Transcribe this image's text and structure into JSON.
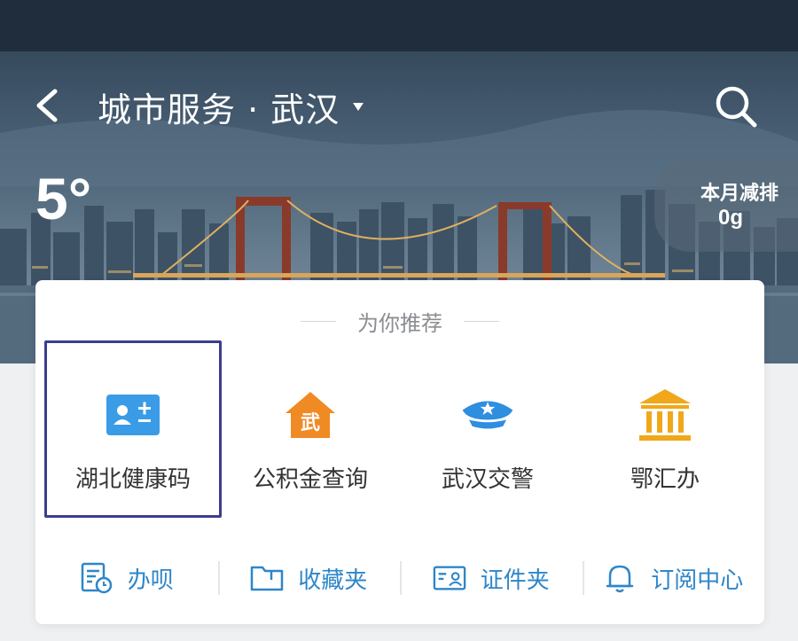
{
  "header": {
    "title": "城市服务 · 武汉",
    "temperature": "5°",
    "emission": {
      "label": "本月减排",
      "value": "0g"
    }
  },
  "recommend": {
    "title": "为你推荐",
    "services": [
      {
        "label": "湖北健康码",
        "icon": "id-card-icon",
        "selected": true,
        "color": "#3a9be6"
      },
      {
        "label": "公积金查询",
        "icon": "house-icon",
        "selected": false,
        "color": "#f08a24"
      },
      {
        "label": "武汉交警",
        "icon": "police-cap-icon",
        "selected": false,
        "color": "#2e8ee0"
      },
      {
        "label": "鄂汇办",
        "icon": "government-building-icon",
        "selected": false,
        "color": "#f0a81a"
      }
    ]
  },
  "bottom_bar": [
    {
      "label": "办呗",
      "icon": "document-clock-icon"
    },
    {
      "label": "收藏夹",
      "icon": "folder-icon"
    },
    {
      "label": "证件夹",
      "icon": "id-card-icon"
    },
    {
      "label": "订阅中心",
      "icon": "bell-icon"
    }
  ],
  "colors": {
    "accent": "#2e86c9",
    "selection": "#3a3d8f"
  }
}
